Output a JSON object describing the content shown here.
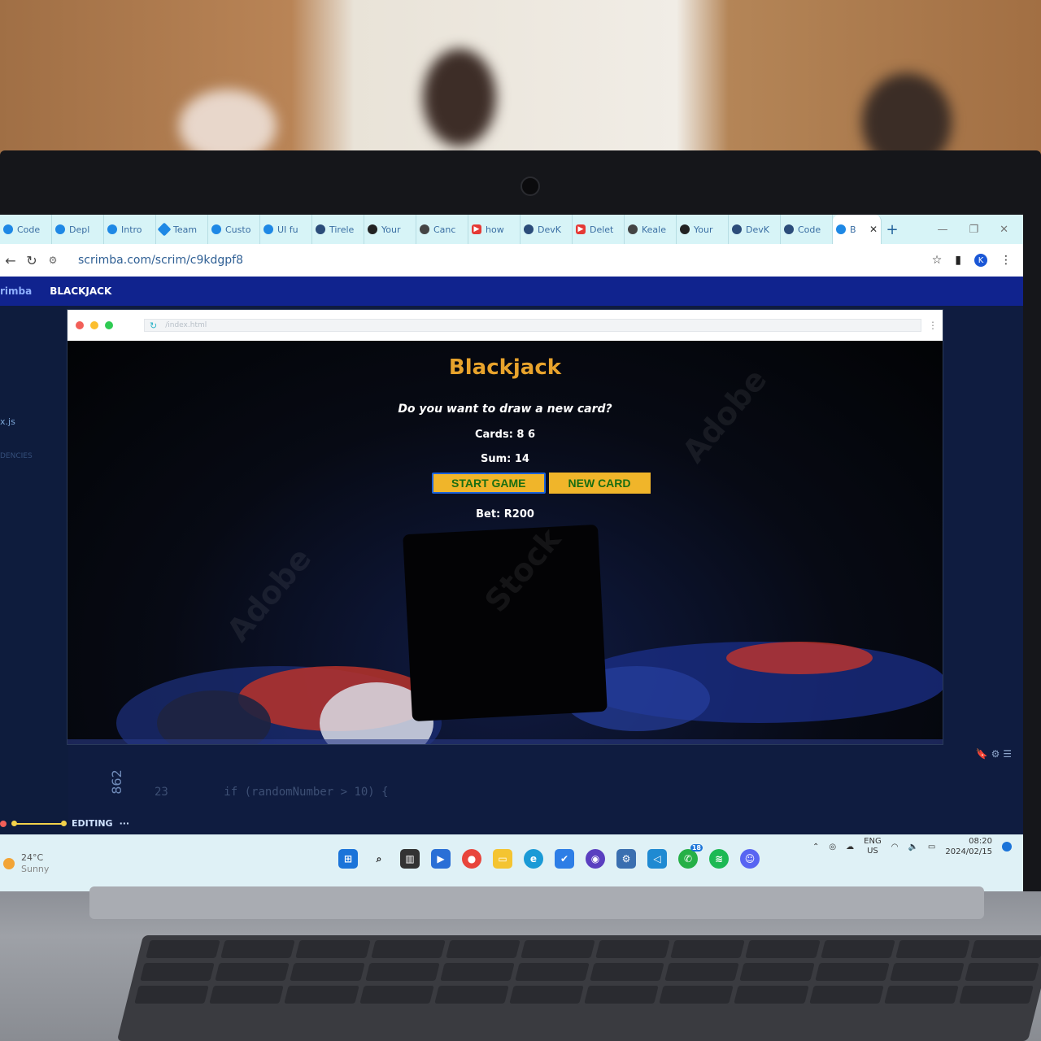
{
  "browser": {
    "tabs": [
      {
        "label": "Code",
        "icon": "scrimba-icon",
        "color": "#1e88e5"
      },
      {
        "label": "Depl",
        "icon": "scrimba-icon",
        "color": "#1e88e5"
      },
      {
        "label": "Intro",
        "icon": "scrimba-icon",
        "color": "#1e88e5"
      },
      {
        "label": "Team",
        "icon": "diamond-icon",
        "color": "#1e88e5"
      },
      {
        "label": "Custo",
        "icon": "scrimba-icon",
        "color": "#1e88e5"
      },
      {
        "label": "UI fu",
        "icon": "scrimba-icon",
        "color": "#1e88e5"
      },
      {
        "label": "Tirele",
        "icon": "globe-icon",
        "color": "#2b4c7a"
      },
      {
        "label": "Your",
        "icon": "github-icon",
        "color": "#222222"
      },
      {
        "label": "Canc",
        "icon": "chatgpt-icon",
        "color": "#444444"
      },
      {
        "label": "how",
        "icon": "youtube-icon",
        "color": "#e53935"
      },
      {
        "label": "DevK",
        "icon": "globe-icon",
        "color": "#2b4c7a"
      },
      {
        "label": "Delet",
        "icon": "youtube-icon",
        "color": "#e53935"
      },
      {
        "label": "Keale",
        "icon": "chatgpt-icon",
        "color": "#444444"
      },
      {
        "label": "Your",
        "icon": "codepen-icon",
        "color": "#222222"
      },
      {
        "label": "DevK",
        "icon": "globe-icon",
        "color": "#2b4c7a"
      },
      {
        "label": "Code",
        "icon": "globe-icon",
        "color": "#2b4c7a"
      },
      {
        "label": "B",
        "icon": "scrimba-icon",
        "color": "#1e88e5",
        "active": true
      }
    ],
    "new_tab": "+",
    "url": "scrimba.com/scrim/c9kdgpf8",
    "profile_initial": "K"
  },
  "scrimba": {
    "brand": "rimba",
    "separator": "/",
    "crumb": "BLACKJACK"
  },
  "sidebar": {
    "file": "x.js",
    "section": "DENCIES"
  },
  "preview": {
    "url_placeholder": "/index.html"
  },
  "game": {
    "title": "Blackjack",
    "message": "Do you want to draw a new card?",
    "cards": "Cards: 8 6",
    "sum": "Sum: 14",
    "start_button": "START GAME",
    "new_card_button": "NEW CARD",
    "bet": "Bet: R200",
    "title_color": "#e8a32c",
    "button_color": "#f0b52a",
    "button_text_color": "#1a6e12"
  },
  "editor": {
    "line_number_rotated": "862",
    "gutter_line": "23",
    "code_line": "if (randomNumber > 10) {",
    "status": "EDITING"
  },
  "taskbar": {
    "weather_temp": "24°C",
    "weather_desc": "Sunny",
    "language": "ENG",
    "region": "US",
    "time": "08:20",
    "date": "2024/02/15",
    "whatsapp_badge": "18"
  }
}
